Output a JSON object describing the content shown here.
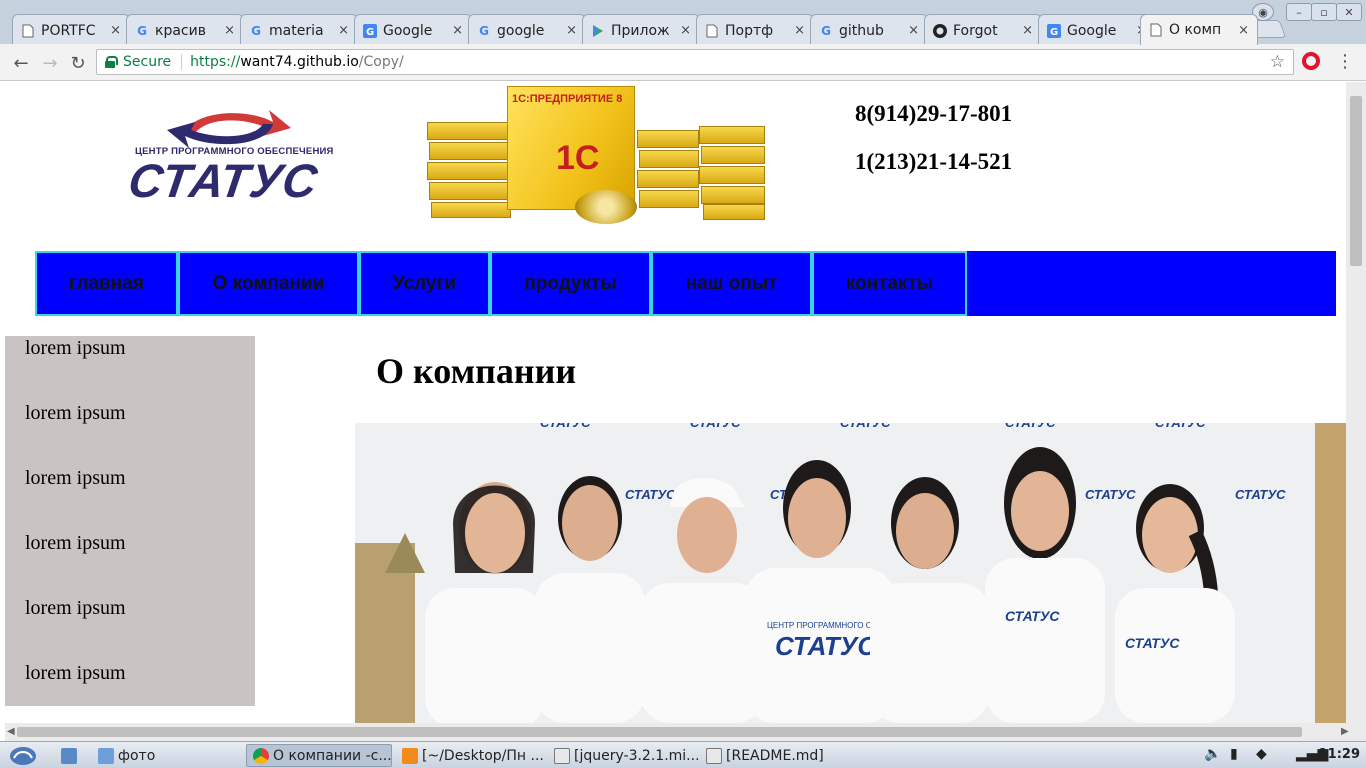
{
  "browser": {
    "tabs": [
      {
        "title": "PORTFC",
        "icon": "page-icon"
      },
      {
        "title": "красив",
        "icon": "google-icon"
      },
      {
        "title": "materia",
        "icon": "google-icon"
      },
      {
        "title": "Google",
        "icon": "google-translate-icon"
      },
      {
        "title": "google",
        "icon": "google-icon"
      },
      {
        "title": "Прилож",
        "icon": "play-store-icon"
      },
      {
        "title": "Портф",
        "icon": "page-icon"
      },
      {
        "title": "github",
        "icon": "google-icon"
      },
      {
        "title": "Forgot",
        "icon": "github-icon"
      },
      {
        "title": "Google",
        "icon": "google-translate-icon"
      },
      {
        "title": "О комп",
        "icon": "page-icon",
        "active": true
      }
    ],
    "close_glyph": "×",
    "secure_label": "Secure",
    "url": {
      "scheme": "https://",
      "host": "want74.github.io",
      "path": "/Copy/"
    }
  },
  "site": {
    "logo": {
      "small_text": "ЦЕНТР ПРОГРАММНОГО ОБЕСПЕЧЕНИЯ",
      "big_text": "СТАТУС"
    },
    "product": {
      "label": "1С:ПРЕДПРИЯТИЕ 8",
      "mark": "1С"
    },
    "phones": [
      "8(914)29-17-801",
      "1(213)21-14-521"
    ],
    "nav": [
      "главная",
      "О компании",
      "Услуги",
      "продукты",
      "наш опыт",
      "контакты"
    ],
    "sidebar": [
      "lorem ipsum",
      "lorem ipsum",
      "lorem ipsum",
      "lorem ipsum",
      "lorem ipsum",
      "lorem ipsum"
    ],
    "content_title": "О компании",
    "photo": {
      "backdrop_text": "СТАТУС",
      "shirt_text": "СТАТУС",
      "badge_text": "ЦЕНТР ПРОГРАММНОГО ОБЕСПЕЧЕНИЯ"
    }
  },
  "taskbar": {
    "items": [
      {
        "label": "фото",
        "icon": "folder-icon"
      },
      {
        "label": "О компании -с...",
        "icon": "chrome-icon",
        "active": true
      },
      {
        "label": "[~/Desktop/Пн ...",
        "icon": "sublime-icon"
      },
      {
        "label": "[jquery-3.2.1.mi...",
        "icon": "text-file-icon"
      },
      {
        "label": "[README.md]",
        "icon": "text-file-icon"
      }
    ],
    "clock": "11:29"
  },
  "colors": {
    "nav_bg": "#0000ff",
    "nav_border": "#3bd3e6",
    "sidebar_bg": "#c9c3c3",
    "logo_navy": "#2e2a6e",
    "logo_red": "#d23a3a"
  }
}
